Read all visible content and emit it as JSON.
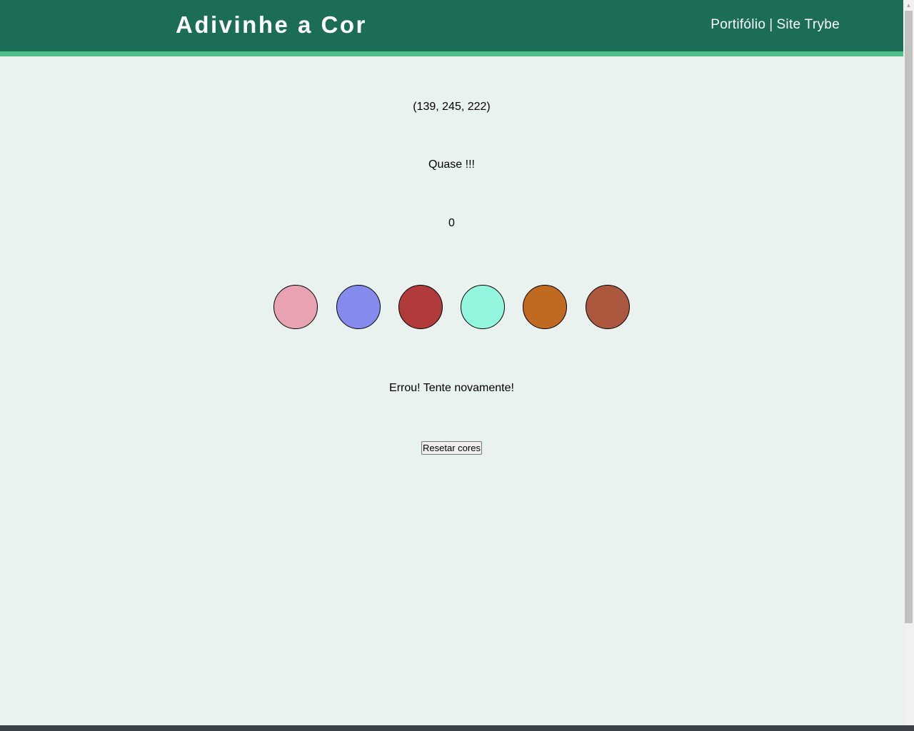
{
  "header": {
    "title": "Adivinhe a Cor",
    "links": {
      "portfolio": "Portifólio",
      "separator": "|",
      "trybe": "Site Trybe"
    }
  },
  "game": {
    "rgb_color": "(139, 245, 222)",
    "hint": "Quase !!!",
    "score": "0",
    "answer": "Errou! Tente novamente!",
    "reset_label": "Resetar cores"
  },
  "balls": [
    {
      "color": "#e8a2b1"
    },
    {
      "color": "#848bec"
    },
    {
      "color": "#b13b3b"
    },
    {
      "color": "#94f6df"
    },
    {
      "color": "#bf6a20"
    },
    {
      "color": "#ab583f"
    }
  ],
  "colors": {
    "header_bg": "#1b6e55",
    "header_accent": "#4fbf8a",
    "page_bg": "#e9f2ef"
  }
}
